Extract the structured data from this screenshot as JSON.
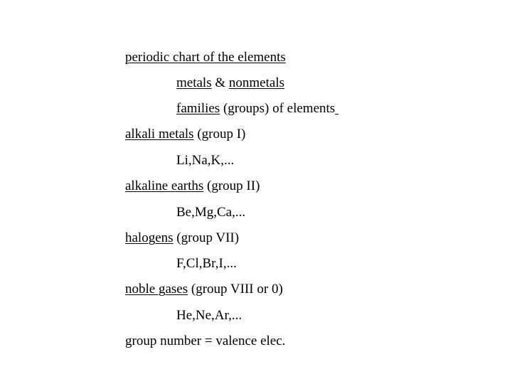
{
  "slide": {
    "lines": [
      {
        "parts": [
          {
            "text": "periodic chart of the elements",
            "underline": true
          }
        ]
      },
      {
        "parts": [
          {
            "text": "metals",
            "underline": true
          },
          {
            "text": " & ",
            "underline": false
          },
          {
            "text": "nonmetals",
            "underline": true
          }
        ]
      },
      {
        "parts": [
          {
            "text": "families",
            "underline": true
          },
          {
            "text": " (groups) of elements",
            "underline": false
          },
          {
            "text": " ",
            "underline": true
          }
        ]
      },
      {
        "parts": [
          {
            "text": "alkali metals",
            "underline": true
          },
          {
            "text": " (group I)",
            "underline": false
          }
        ]
      },
      {
        "parts": [
          {
            "text": "Li,Na,K,...",
            "underline": false
          }
        ]
      },
      {
        "parts": [
          {
            "text": "alkaline earths",
            "underline": true
          },
          {
            "text": " (group II)",
            "underline": false
          }
        ]
      },
      {
        "parts": [
          {
            "text": "Be,Mg,Ca,...",
            "underline": false
          }
        ]
      },
      {
        "parts": [
          {
            "text": "halogens",
            "underline": true
          },
          {
            "text": " (group VII)",
            "underline": false
          }
        ]
      },
      {
        "parts": [
          {
            "text": "F,Cl,Br,I,...",
            "underline": false
          }
        ]
      },
      {
        "parts": [
          {
            "text": "noble gases",
            "underline": true
          },
          {
            "text": " (group VIII or 0)",
            "underline": false
          }
        ]
      },
      {
        "parts": [
          {
            "text": "He,Ne,Ar,...",
            "underline": false
          }
        ]
      },
      {
        "parts": [
          {
            "text": "group number = valence elec.",
            "underline": false
          }
        ]
      }
    ]
  }
}
